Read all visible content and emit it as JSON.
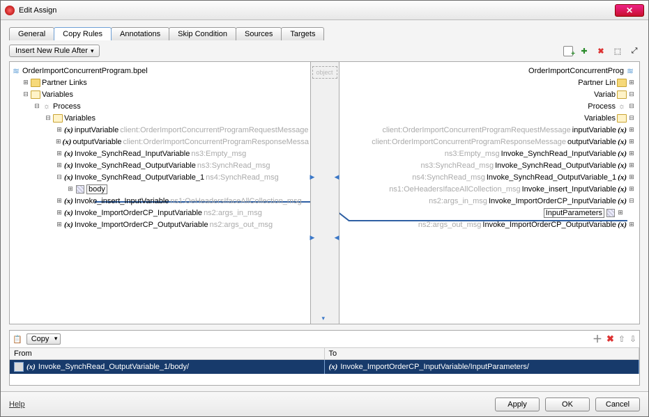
{
  "window": {
    "title": "Edit Assign",
    "close": "✕"
  },
  "tabs": [
    "General",
    "Copy Rules",
    "Annotations",
    "Skip Condition",
    "Sources",
    "Targets"
  ],
  "activeTab": 1,
  "insertRule": {
    "label": "Insert New Rule After"
  },
  "dividerLabel": "object",
  "bpelFile": "OrderImportConcurrentProgram.bpel",
  "leftTree": {
    "partnerLinks": "Partner Links",
    "variables": "Variables",
    "process": "Process",
    "varsInner": "Variables",
    "items": [
      {
        "name": "inputVariable",
        "hint": "client:OrderImportConcurrentProgramRequestMessage"
      },
      {
        "name": "outputVariable",
        "hint": "client:OrderImportConcurrentProgramResponseMessa"
      },
      {
        "name": "Invoke_SynchRead_InputVariable",
        "hint": "ns3:Empty_msg"
      },
      {
        "name": "Invoke_SynchRead_OutputVariable",
        "hint": "ns3:SynchRead_msg"
      },
      {
        "name": "Invoke_SynchRead_OutputVariable_1",
        "hint": "ns4:SynchRead_msg",
        "expanded": true,
        "child": "body"
      },
      {
        "name": "Invoke_insert_InputVariable",
        "hint": "ns1:OeHeadersIfaceAllCollection_msg"
      },
      {
        "name": "Invoke_ImportOrderCP_InputVariable",
        "hint": "ns2:args_in_msg"
      },
      {
        "name": "Invoke_ImportOrderCP_OutputVariable",
        "hint": "ns2:args_out_msg"
      }
    ]
  },
  "rightTree": {
    "file": "OrderImportConcurrentProg",
    "partnerLinks": "Partner Lin",
    "variables": "Variab",
    "process": "Process",
    "varsInner": "Variables",
    "items": [
      {
        "name": "inputVariable",
        "hint": "client:OrderImportConcurrentProgramRequestMessage"
      },
      {
        "name": "outputVariable",
        "hint": "client:OrderImportConcurrentProgramResponseMessage"
      },
      {
        "name": "Invoke_SynchRead_InputVariable",
        "hint": "ns3:Empty_msg"
      },
      {
        "name": "Invoke_SynchRead_OutputVariable",
        "hint": "ns3:SynchRead_msg"
      },
      {
        "name": "Invoke_SynchRead_OutputVariable_1",
        "hint": "ns4:SynchRead_msg"
      },
      {
        "name": "Invoke_insert_InputVariable",
        "hint": "ns1:OeHeadersIfaceAllCollection_msg"
      },
      {
        "name": "Invoke_ImportOrderCP_InputVariable",
        "hint": "ns2:args_in_msg",
        "expanded": true,
        "child": "InputParameters"
      },
      {
        "name": "Invoke_ImportOrderCP_OutputVariable",
        "hint": "ns2:args_out_msg"
      }
    ]
  },
  "copy": {
    "selector": "Copy",
    "headers": {
      "from": "From",
      "to": "To"
    },
    "row": {
      "from": "Invoke_SynchRead_OutputVariable_1/body/",
      "to": "Invoke_ImportOrderCP_InputVariable/InputParameters/"
    }
  },
  "footer": {
    "help": "Help",
    "apply": "Apply",
    "ok": "OK",
    "cancel": "Cancel"
  }
}
